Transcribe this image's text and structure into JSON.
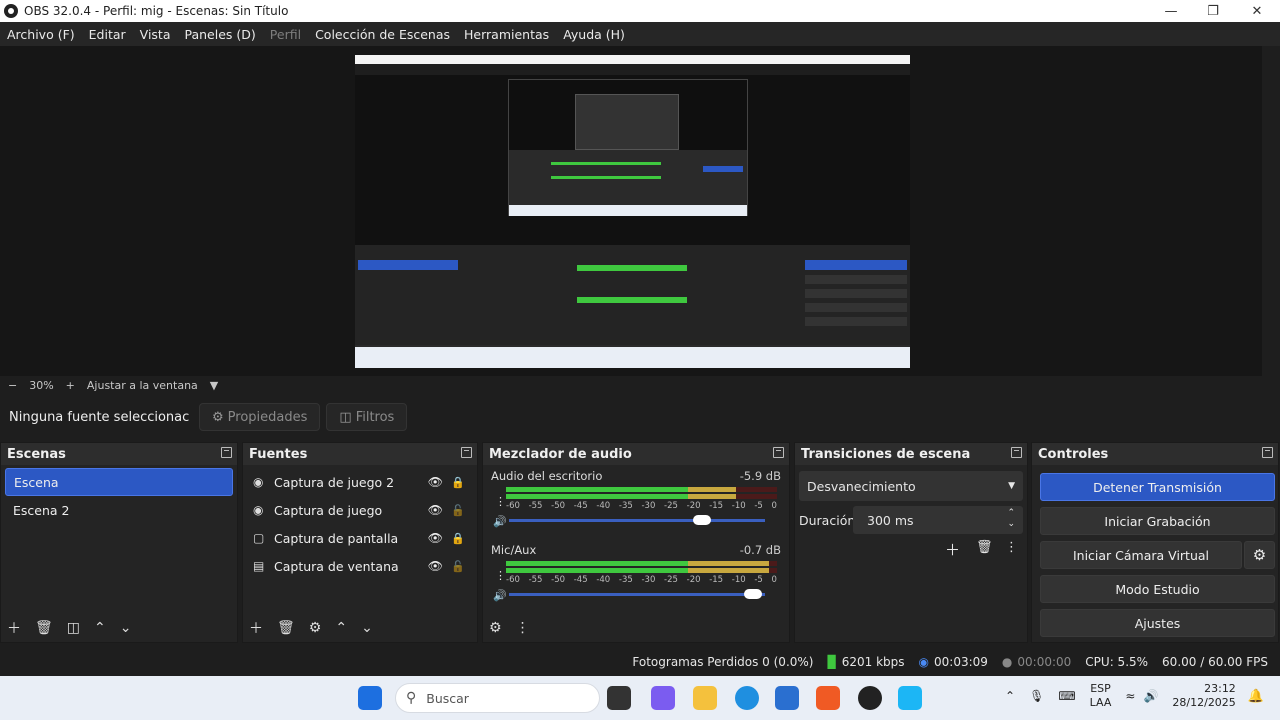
{
  "window": {
    "title": "OBS 32.0.4 - Perfil: mig - Escenas: Sin Título"
  },
  "menu": [
    "Archivo (F)",
    "Editar",
    "Vista",
    "Paneles (D)",
    "Perfil",
    "Colección de Escenas",
    "Herramientas",
    "Ayuda (H)"
  ],
  "menu_disabled_index": 4,
  "zoom": {
    "minus": "−",
    "value": "30%",
    "plus": "+",
    "fit": "Ajustar a la ventana"
  },
  "source_toolbar": {
    "no_source": "Ninguna fuente seleccionac",
    "properties": "Propiedades",
    "filters": "Filtros"
  },
  "scenes": {
    "title": "Escenas",
    "items": [
      "Escena",
      "Escena 2"
    ],
    "selected": 0
  },
  "sources": {
    "title": "Fuentes",
    "items": [
      {
        "name": "Captura de juego 2",
        "icon": "gamepad-icon",
        "locked": true
      },
      {
        "name": "Captura de juego",
        "icon": "gamepad-icon",
        "locked": false
      },
      {
        "name": "Captura de pantalla",
        "icon": "monitor-icon",
        "locked": true
      },
      {
        "name": "Captura de ventana",
        "icon": "window-icon",
        "locked": false
      }
    ]
  },
  "mixer": {
    "title": "Mezclador de audio",
    "channels": [
      {
        "name": "Audio del escritorio",
        "db": "-5.9 dB",
        "level": 0.85,
        "volume": 0.79
      },
      {
        "name": "Mic/Aux",
        "db": "-0.7 dB",
        "level": 0.97,
        "volume": 0.99
      }
    ],
    "ticks": [
      "-60",
      "-55",
      "-50",
      "-45",
      "-40",
      "-35",
      "-30",
      "-25",
      "-20",
      "-15",
      "-10",
      "-5",
      "0"
    ]
  },
  "transitions": {
    "title": "Transiciones de escena",
    "selected": "Desvanecimiento",
    "duration_label": "Duración",
    "duration": "300 ms"
  },
  "controls": {
    "title": "Controles",
    "stop_stream": "Detener Transmisión",
    "start_rec": "Iniciar Grabación",
    "virtual_cam": "Iniciar Cámara Virtual",
    "studio": "Modo Estudio",
    "settings": "Ajustes"
  },
  "status": {
    "dropped": "Fotogramas Perdidos 0 (0.0%)",
    "kbps": "6201 kbps",
    "stream_time": "00:03:09",
    "rec_time": "00:00:00",
    "cpu": "CPU: 5.5%",
    "fps": "60.00 / 60.00 FPS"
  },
  "taskbar": {
    "search": "Buscar",
    "lang1": "ESP",
    "lang2": "LAA",
    "time": "23:12",
    "date": "28/12/2025"
  },
  "colors": {
    "accent": "#2c58c4",
    "dock_bg": "#242424",
    "meter_green": "#3fc83f",
    "meter_yellow": "#c8a83f",
    "meter_red": "#4b1a1a"
  }
}
